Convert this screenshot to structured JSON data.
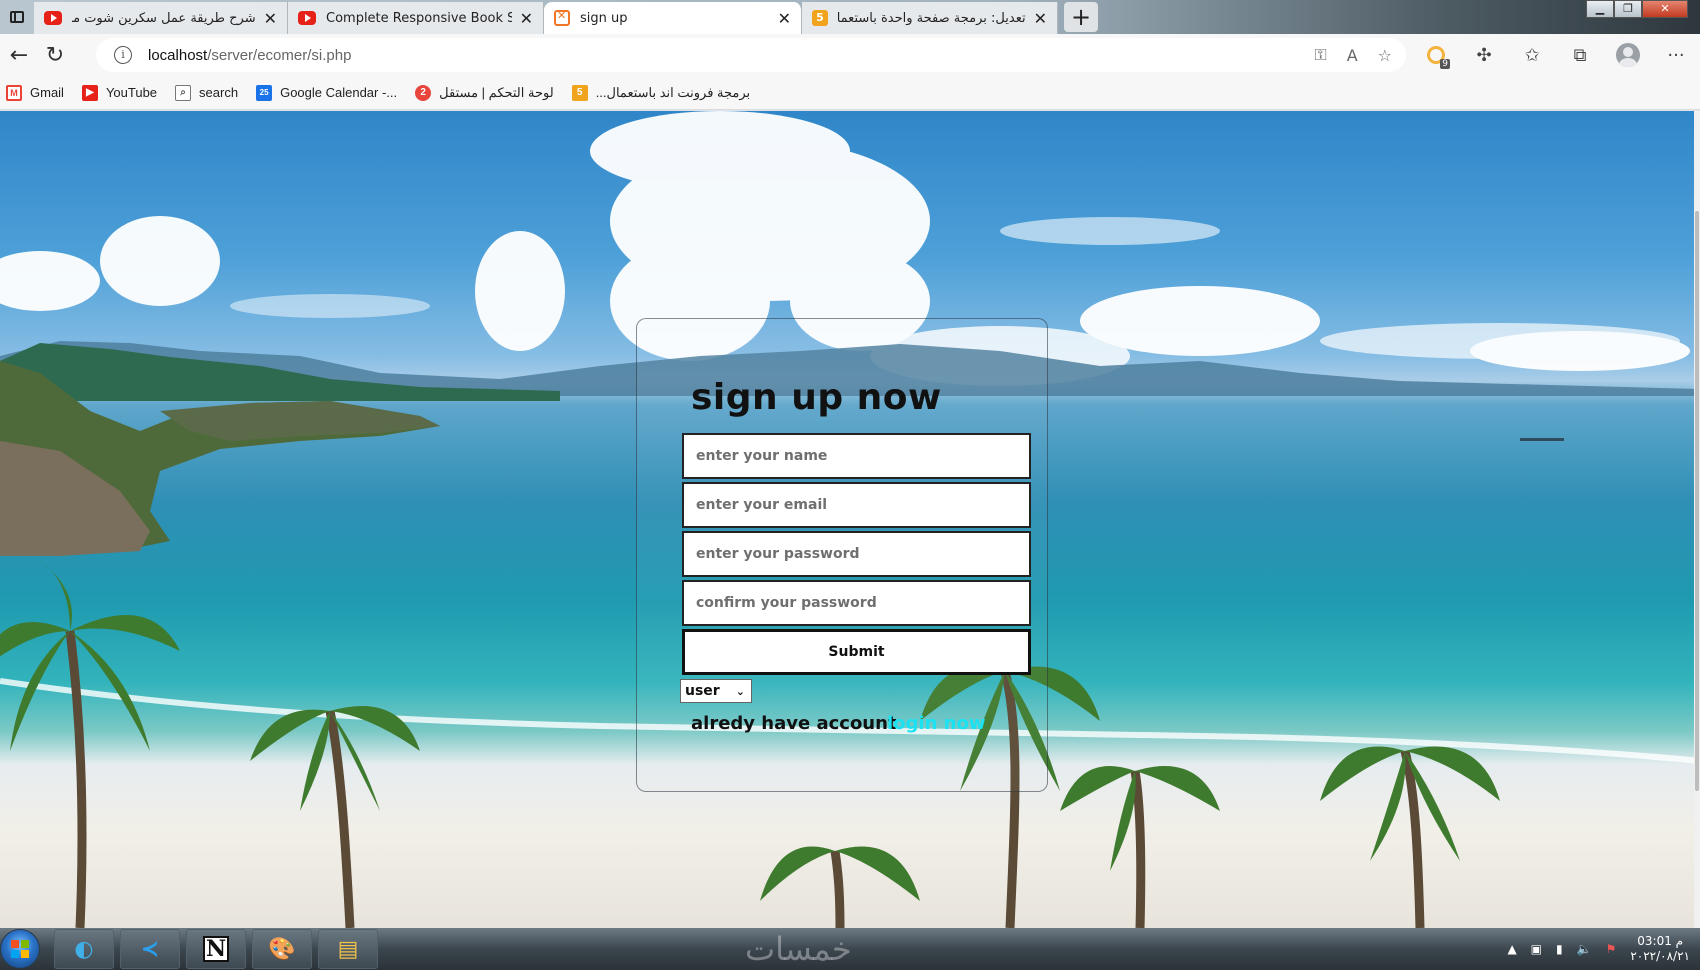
{
  "browser": {
    "tabs": [
      {
        "title": "شرح طريقة عمل سكرين شوت من الكمبيوتر",
        "icon": "youtube-icon",
        "active": false
      },
      {
        "title": "Complete Responsive Book Store",
        "icon": "youtube-icon",
        "active": false
      },
      {
        "title": "sign up",
        "icon": "xampp-icon",
        "active": true
      },
      {
        "title": "تعديل: برمجة صفحة واحدة باستعمال mysql",
        "icon": "five-icon",
        "active": false
      }
    ],
    "url_host": "localhost",
    "url_path": "/server/ecomer/si.php",
    "extension_badge": "9",
    "bookmarks": [
      {
        "label": "Gmail",
        "icon": "gmail-icon"
      },
      {
        "label": "YouTube",
        "icon": "youtube-icon"
      },
      {
        "label": "search",
        "icon": "search-icon"
      },
      {
        "label": "Google Calendar -...",
        "icon": "calendar-icon"
      },
      {
        "label": "لوحة التحكم | مستقل",
        "icon": "mostaql-icon"
      },
      {
        "label": "برمجة فرونت اند باستعمال...",
        "icon": "five-icon"
      }
    ]
  },
  "signup": {
    "heading": "sign up now",
    "name_placeholder": "enter your name",
    "email_placeholder": "enter your email",
    "password_placeholder": "enter your password",
    "confirm_placeholder": "confirm your password",
    "submit_label": "Submit",
    "role_selected": "user",
    "already_text": "alredy have account",
    "login_link": "login now",
    "link_color": "#19e3f2"
  },
  "taskbar": {
    "apps": [
      "edge-icon",
      "vscode-icon",
      "notion-icon",
      "paint-icon",
      "explorer-icon"
    ],
    "time": "03:01 م",
    "date": "٢٠٢٢/٠٨/٢١",
    "watermark": "خمسات"
  }
}
